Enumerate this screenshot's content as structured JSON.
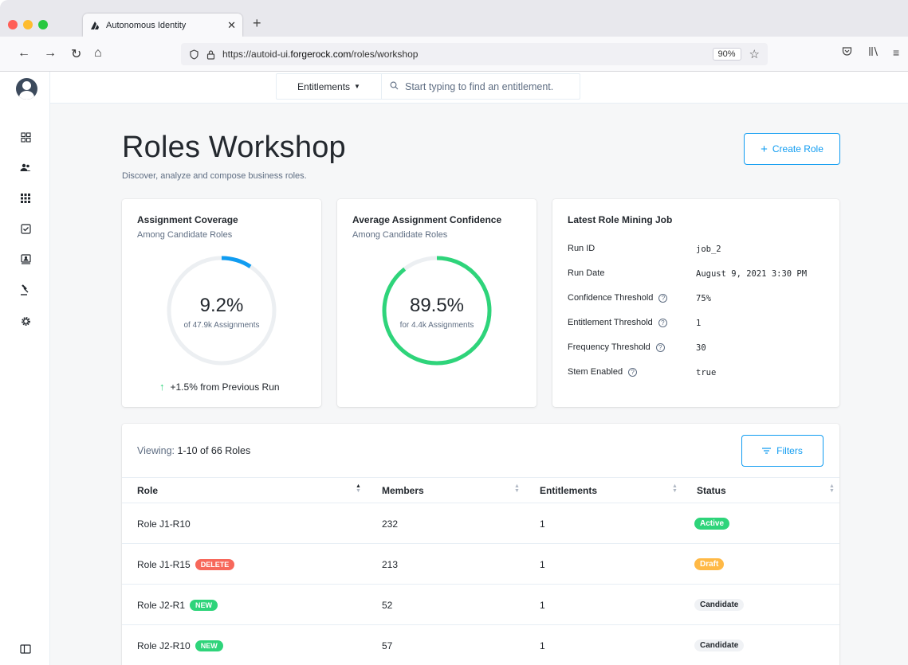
{
  "browser": {
    "tab_title": "Autonomous Identity",
    "url_prefix": "https://autoid-ui.",
    "url_domain": "forgerock.com",
    "url_path": "/roles/workshop",
    "zoom": "90%"
  },
  "search": {
    "type_label": "Entitlements",
    "placeholder": "Start typing to find an entitlement."
  },
  "header": {
    "title": "Roles Workshop",
    "subtitle": "Discover, analyze and compose business roles.",
    "create_label": "Create Role"
  },
  "coverage": {
    "title": "Assignment Coverage",
    "subtitle": "Among Candidate Roles",
    "value": "9.2%",
    "value_fraction": 0.092,
    "caption": "of 47.9k Assignments",
    "trend": "+1.5% from Previous Run",
    "color": "#109cf1"
  },
  "confidence": {
    "title": "Average Assignment Confidence",
    "subtitle": "Among Candidate Roles",
    "value": "89.5%",
    "value_fraction": 0.895,
    "caption": "for 4.4k Assignments",
    "color": "#2ed47a"
  },
  "job": {
    "title": "Latest Role Mining Job",
    "rows": [
      {
        "label": "Run ID",
        "value": "job_2",
        "help": false
      },
      {
        "label": "Run Date",
        "value": "August 9, 2021 3:30 PM",
        "help": false
      },
      {
        "label": "Confidence Threshold",
        "value": "75%",
        "help": true
      },
      {
        "label": "Entitlement Threshold",
        "value": "1",
        "help": true
      },
      {
        "label": "Frequency Threshold",
        "value": "30",
        "help": true
      },
      {
        "label": "Stem Enabled",
        "value": "true",
        "help": true
      }
    ]
  },
  "table": {
    "viewing_label": "Viewing:",
    "viewing_value": "1-10 of 66 Roles",
    "filters_label": "Filters",
    "columns": [
      "Role",
      "Members",
      "Entitlements",
      "Status"
    ],
    "rows": [
      {
        "role": "Role J1-R10",
        "badge": "",
        "members": "232",
        "entitlements": "1",
        "status": "Active"
      },
      {
        "role": "Role J1-R15",
        "badge": "DELETE",
        "members": "213",
        "entitlements": "1",
        "status": "Draft"
      },
      {
        "role": "Role J2-R1",
        "badge": "NEW",
        "members": "52",
        "entitlements": "1",
        "status": "Candidate"
      },
      {
        "role": "Role J2-R10",
        "badge": "NEW",
        "members": "57",
        "entitlements": "1",
        "status": "Candidate"
      }
    ]
  }
}
